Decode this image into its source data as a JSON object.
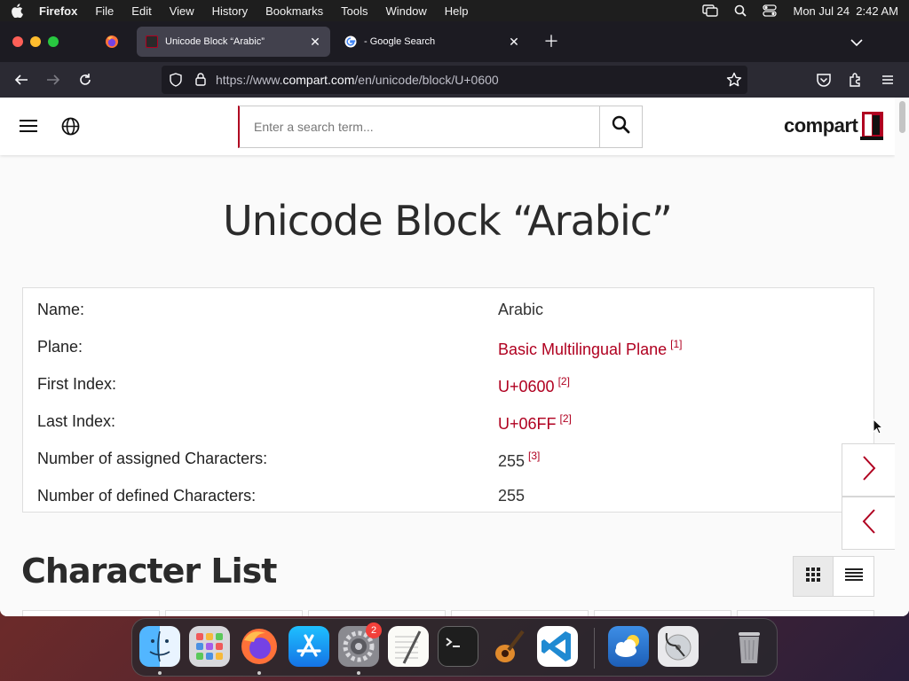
{
  "menubar": {
    "app": "Firefox",
    "items": [
      "File",
      "Edit",
      "View",
      "History",
      "Bookmarks",
      "Tools",
      "Window",
      "Help"
    ],
    "datetime": "Mon Jul 24  2:42 AM"
  },
  "tabs": [
    {
      "title": "Unicode Block “Arabic”",
      "active": true
    },
    {
      "title": "- Google Search",
      "active": false
    }
  ],
  "urlbar": {
    "prefix": "https://www.",
    "domain": "compart.com",
    "path": "/en/unicode/block/U+0600"
  },
  "site": {
    "search_placeholder": "Enter a search term...",
    "logo": "compart"
  },
  "page_title": "Unicode Block “Arabic”",
  "info": {
    "name_key": "Name:",
    "name_val": "Arabic",
    "plane_key": "Plane:",
    "plane_val": "Basic Multilingual Plane",
    "plane_ref": "[1]",
    "first_key": "First Index:",
    "first_val": "U+0600",
    "first_ref": "[2]",
    "last_key": "Last Index:",
    "last_val": "U+06FF",
    "last_ref": "[2]",
    "assigned_key": "Number of assigned Characters:",
    "assigned_val": "255",
    "assigned_ref": "[3]",
    "defined_key": "Number of defined Characters:",
    "defined_val": "255"
  },
  "section_title": "Character List",
  "dock": {
    "settings_badge": "2",
    "apps": [
      "finder-icon",
      "launchpad-icon",
      "firefox-icon",
      "app-store-icon",
      "system-settings-icon",
      "textedit-icon",
      "terminal-icon",
      "garageband-icon",
      "vscode-icon",
      "weather-icon",
      "disk-utility-icon",
      "trash-icon"
    ]
  },
  "colors": {
    "accent": "#b00020",
    "tab_bar": "#1c1b22",
    "nav_bar": "#2b2a33"
  }
}
